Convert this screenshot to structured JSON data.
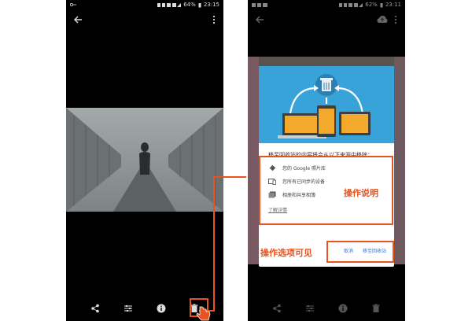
{
  "left_screen": {
    "status_bar": {
      "battery": "64%",
      "time": "23:15"
    }
  },
  "right_screen": {
    "status_bar": {
      "battery": "62%",
      "time": "23:11"
    },
    "dialog": {
      "title": "移至回收站的内容将会从以下来源中移除：",
      "items": [
        {
          "icon": "photos-pinwheel-icon",
          "label": "您的 Google 照片库"
        },
        {
          "icon": "devices-icon",
          "label": "您所有已同步的设备"
        },
        {
          "icon": "shared-album-icon",
          "label": "相册和共享相簿"
        }
      ],
      "learn_more": "了解详情",
      "cancel_label": "取消",
      "confirm_label": "移至回收站"
    }
  },
  "annotations": {
    "description_label": "操作说明",
    "options_label": "操作选项可见"
  },
  "colors": {
    "accent": "#e8531f",
    "dialog_header": "#37a3d8",
    "button_blue": "#2f74d0"
  }
}
